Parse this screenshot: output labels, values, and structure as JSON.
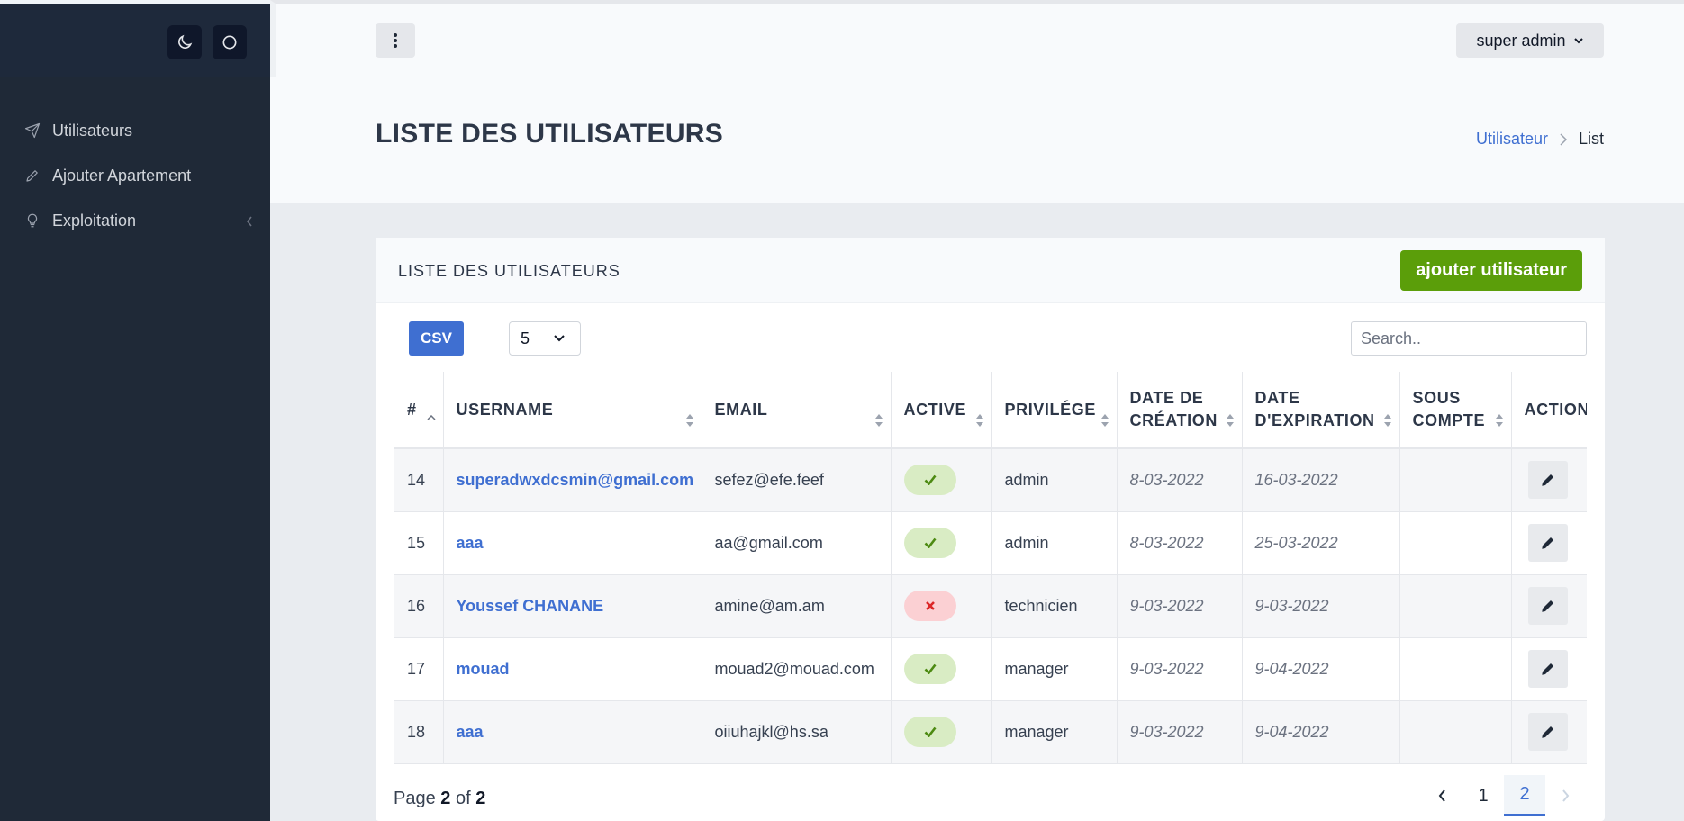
{
  "sidebar": {
    "items": [
      {
        "label": "Utilisateurs",
        "icon": "send-icon"
      },
      {
        "label": "Ajouter Apartement",
        "icon": "pencil-icon"
      },
      {
        "label": "Exploitation",
        "icon": "lightbulb-icon"
      }
    ],
    "top_buttons": [
      "moon-icon",
      "circle-icon"
    ]
  },
  "header": {
    "user_menu_label": "super admin"
  },
  "page": {
    "title": "LISTE DES UTILISATEURS",
    "breadcrumb": [
      "Utilisateur",
      "List"
    ]
  },
  "card": {
    "title": "LISTE DES UTILISATEURS",
    "add_button_label": "ajouter utilisateur",
    "csv_label": "CSV",
    "page_size": "5",
    "search_placeholder": "Search.."
  },
  "table": {
    "headers": {
      "num": "#",
      "username": "USERNAME",
      "email": "EMAIL",
      "active": "ACTIVE",
      "privilege": "PRIVILÉGE",
      "creation_1": "DATE DE",
      "creation_2": "CRÉATION",
      "expiration_1": "DATE",
      "expiration_2": "D'EXPIRATION",
      "sous_1": "SOUS",
      "sous_2": "COMPTE",
      "actions": "ACTIONS"
    },
    "rows": [
      {
        "id": "14",
        "username": "superadwxdcsmin@gmail.com",
        "email": "sefez@efe.feef",
        "active": true,
        "privilege": "admin",
        "created": "8-03-2022",
        "expires": "16-03-2022",
        "sous_compte": ""
      },
      {
        "id": "15",
        "username": "aaa",
        "email": "aa@gmail.com",
        "active": true,
        "privilege": "admin",
        "created": "8-03-2022",
        "expires": "25-03-2022",
        "sous_compte": ""
      },
      {
        "id": "16",
        "username": "Youssef CHANANE",
        "email": "amine@am.am",
        "active": false,
        "privilege": "technicien",
        "created": "9-03-2022",
        "expires": "9-03-2022",
        "sous_compte": ""
      },
      {
        "id": "17",
        "username": "mouad",
        "email": "mouad2@mouad.com",
        "active": true,
        "privilege": "manager",
        "created": "9-03-2022",
        "expires": "9-04-2022",
        "sous_compte": ""
      },
      {
        "id": "18",
        "username": "aaa",
        "email": "oiiuhajkl@hs.sa",
        "active": true,
        "privilege": "manager",
        "created": "9-03-2022",
        "expires": "9-04-2022",
        "sous_compte": ""
      }
    ]
  },
  "pagination": {
    "label_page": "Page",
    "current": "2",
    "label_of": "of",
    "total": "2",
    "pages": [
      "1",
      "2"
    ]
  },
  "colors": {
    "sidebar_bg": "#1f2937",
    "accent_blue": "#3f6fd1",
    "accent_green": "#5b9e0a",
    "active_on": "#d9ecc4",
    "active_off": "#fbd0d3"
  }
}
